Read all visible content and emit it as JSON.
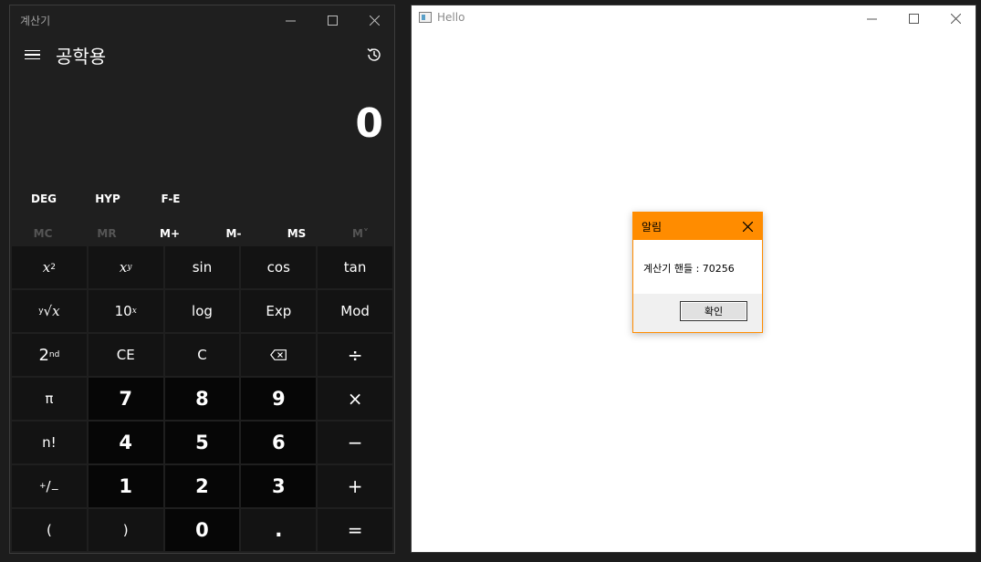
{
  "calculator": {
    "window_title": "계산기",
    "mode_title": "공학용",
    "display_value": "0",
    "function_row": [
      "DEG",
      "HYP",
      "F-E"
    ],
    "memory_row": [
      {
        "label": "MC",
        "enabled": false
      },
      {
        "label": "MR",
        "enabled": false
      },
      {
        "label": "M+",
        "enabled": true
      },
      {
        "label": "M-",
        "enabled": true
      },
      {
        "label": "MS",
        "enabled": true
      },
      {
        "label": "M˅",
        "enabled": false
      }
    ],
    "keys": {
      "sin": "sin",
      "cos": "cos",
      "tan": "tan",
      "log": "log",
      "exp": "Exp",
      "mod": "Mod",
      "ce": "CE",
      "c": "C",
      "divide": "÷",
      "pi": "π",
      "d7": "7",
      "d8": "8",
      "d9": "9",
      "multiply": "×",
      "factorial": "n!",
      "d4": "4",
      "d5": "5",
      "d6": "6",
      "minus": "−",
      "d1": "1",
      "d2": "2",
      "d3": "3",
      "plus": "+",
      "open_paren": "(",
      "close_paren": ")",
      "d0": "0",
      "decimal": ".",
      "equals": "="
    }
  },
  "hello_window": {
    "title": "Hello"
  },
  "dialog": {
    "title": "알림",
    "message": "계산기 핸들 : 70256",
    "ok_label": "확인",
    "accent_color": "#ff8c00"
  }
}
